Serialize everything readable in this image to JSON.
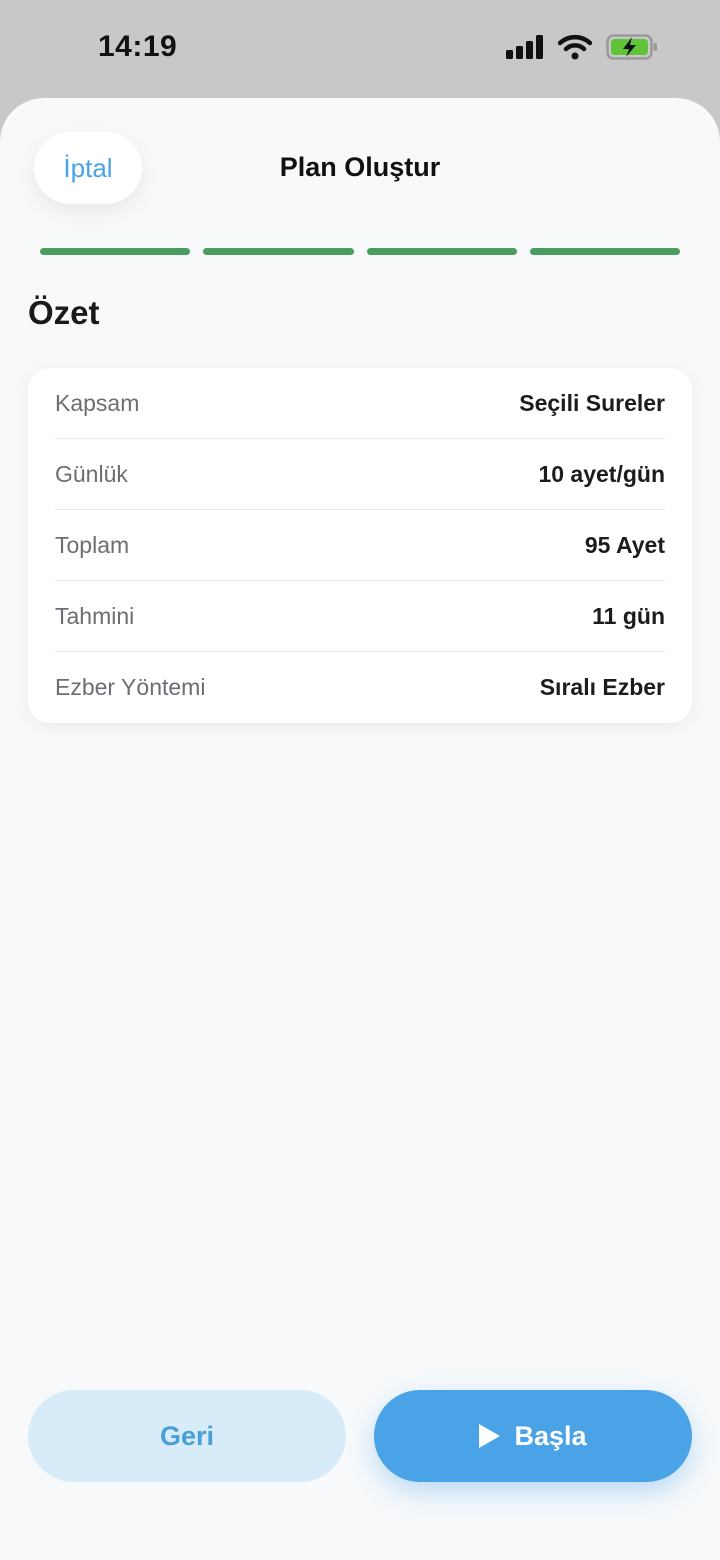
{
  "status_bar": {
    "time": "14:19"
  },
  "header": {
    "cancel_label": "İptal",
    "title": "Plan Oluştur"
  },
  "steps": {
    "total": 4,
    "completed": 4,
    "color": "#4a9d5e"
  },
  "summary": {
    "title": "Özet",
    "rows": [
      {
        "label": "Kapsam",
        "value": "Seçili Sureler"
      },
      {
        "label": "Günlük",
        "value": "10 ayet/gün"
      },
      {
        "label": "Toplam",
        "value": "95 Ayet"
      },
      {
        "label": "Tahmini",
        "value": "11 gün"
      },
      {
        "label": "Ezber Yöntemi",
        "value": "Sıralı Ezber"
      }
    ]
  },
  "footer": {
    "back_label": "Geri",
    "start_label": "Başla"
  },
  "colors": {
    "accent": "#4aa3e6",
    "battery": "#5fc437"
  },
  "icons": [
    "cellular-signal-icon",
    "wifi-icon",
    "battery-charging-icon",
    "play-icon"
  ]
}
